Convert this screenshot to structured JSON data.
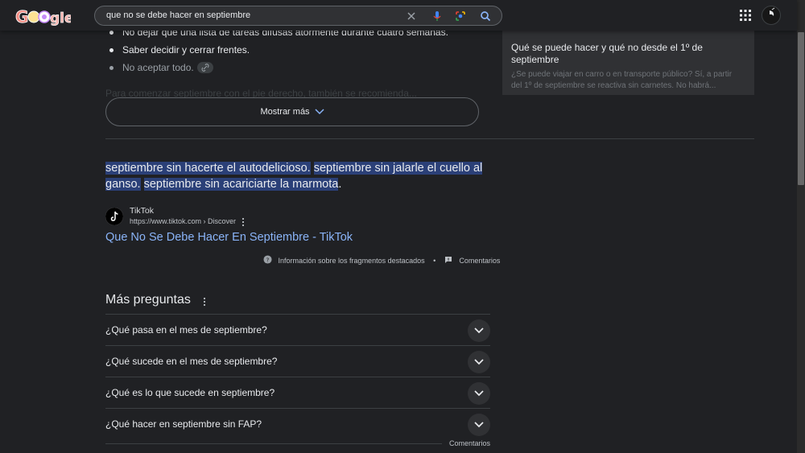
{
  "header": {
    "logo_alt": "Google",
    "query": "que no se debe hacer en septiembre"
  },
  "bullets": [
    {
      "text": "No dejar que una lista de tareas difusas atormente durante cuatro semanas."
    },
    {
      "text": "Saber decidir y cerrar frentes."
    },
    {
      "text": "No aceptar todo."
    }
  ],
  "faded_text": "Para comenzar septiembre con el pie derecho, también se recomienda...",
  "show_more_label": "Mostrar más",
  "side_card": {
    "title": "Qué se puede hacer y qué no desde el 1º de septiembre",
    "snippet": "¿Se puede viajar en carro o en transporte público? Sí, a partir del 1º de septiembre se reactiva sin carnetes. No habrá..."
  },
  "featured": {
    "segments": [
      {
        "text": "septiembre sin hacerte el autodelicioso.",
        "highlight": true
      },
      {
        "text": " ",
        "highlight": false
      },
      {
        "text": "septiembre sin jalarle el cuello al ganso.",
        "highlight": true
      },
      {
        "text": " ",
        "highlight": false
      },
      {
        "text": "septiembre sin acariciarte la marmota",
        "highlight": true
      },
      {
        "text": ".",
        "highlight": false
      }
    ],
    "source_name": "TikTok",
    "source_url": "https://www.tiktok.com › Discover",
    "result_title": "Que No Se Debe Hacer En Septiembre - TikTok",
    "about_label": "Información sobre los fragmentos destacados",
    "feedback_label": "Comentarios"
  },
  "paa": {
    "title": "Más preguntas",
    "questions": [
      "¿Qué pasa en el mes de septiembre?",
      "¿Qué sucede en el mes de septiembre?",
      "¿Qué es lo que sucede en septiembre?",
      "¿Qué hacer en septiembre sin FAP?"
    ],
    "feedback_label": "Comentarios"
  },
  "colors": {
    "background": "#202124",
    "link": "#8ab4f8",
    "highlight": "#2b4078",
    "card": "#303134"
  }
}
